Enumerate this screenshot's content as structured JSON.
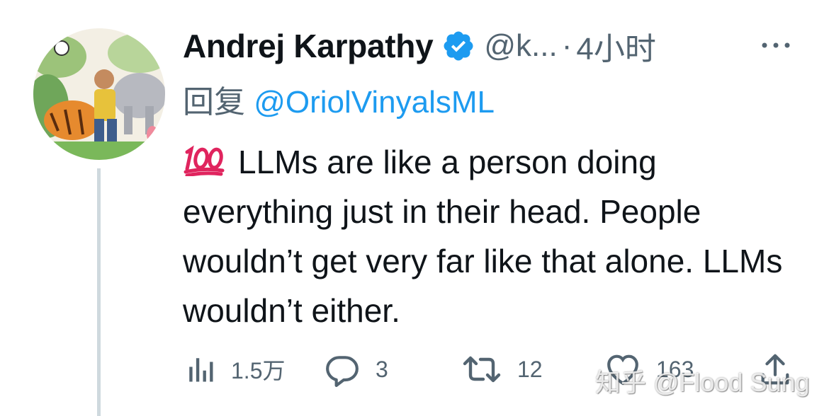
{
  "tweet": {
    "author_name": "Andrej Karpathy",
    "handle": "@k...",
    "separator": "·",
    "time": "4小时",
    "reply_prefix": "回复",
    "reply_to": "@OriolVinyalsML",
    "emoji": "💯",
    "text": "LLMs are like a person doing everything just in their head. People wouldn’t get very far like that alone. LLMs wouldn’t either."
  },
  "actions": {
    "views": "1.5万",
    "replies": "3",
    "retweets": "12",
    "likes": "163"
  },
  "watermark": "知乎 @Flood Sung",
  "colors": {
    "text": "#0f1419",
    "secondary": "#536471",
    "link": "#1d9bf0",
    "thread_line": "#cfd9de",
    "hundred_emoji": "#e0245e"
  },
  "icons": {
    "verified": "verified-badge-icon",
    "more": "more-options-icon",
    "views": "views-chart-icon",
    "reply": "reply-bubble-icon",
    "retweet": "retweet-icon",
    "like": "heart-icon",
    "share": "share-icon"
  }
}
